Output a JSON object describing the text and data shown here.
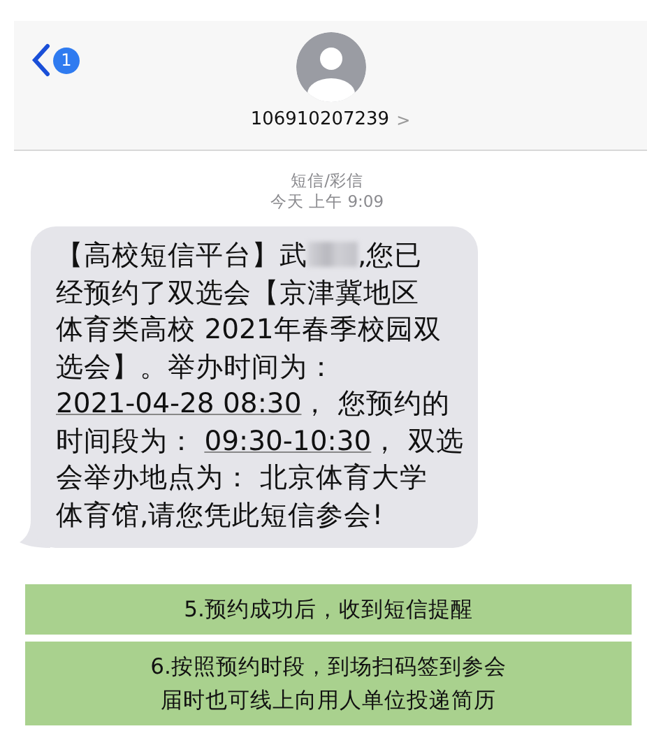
{
  "header": {
    "unread_badge": "1",
    "contact": "106910207239",
    "chevron": ">"
  },
  "conversation": {
    "service": "短信/彩信",
    "timestamp": "今天 上午 9:09",
    "message": {
      "lines": [
        [
          {
            "kind": "plain",
            "text": "【高校短信平台】武"
          },
          {
            "kind": "redacted"
          },
          {
            "kind": "plain",
            "text": ",您已"
          }
        ],
        [
          {
            "kind": "plain",
            "text": "经预约了双选会【京津冀地区"
          }
        ],
        [
          {
            "kind": "plain",
            "text": "体育类高校 2021年春季校园双"
          }
        ],
        [
          {
            "kind": "plain",
            "text": "选会】。举办时间为："
          }
        ],
        [
          {
            "kind": "link",
            "text": "2021-04-28 08:30"
          },
          {
            "kind": "plain",
            "text": "， 您预约的"
          }
        ],
        [
          {
            "kind": "plain",
            "text": "时间段为： "
          },
          {
            "kind": "link",
            "text": "09:30-10:30"
          },
          {
            "kind": "plain",
            "text": "， 双选"
          }
        ],
        [
          {
            "kind": "plain",
            "text": "会举办地点为： 北京体育大学"
          }
        ],
        [
          {
            "kind": "plain",
            "text": "体育馆,请您凭此短信参会!"
          }
        ]
      ]
    }
  },
  "captions": [
    {
      "lines": [
        "5.预约成功后，收到短信提醒"
      ]
    },
    {
      "lines": [
        "6.按照预约时段，到场扫码签到参会",
        "届时也可线上向用人单位投递简历"
      ]
    }
  ]
}
